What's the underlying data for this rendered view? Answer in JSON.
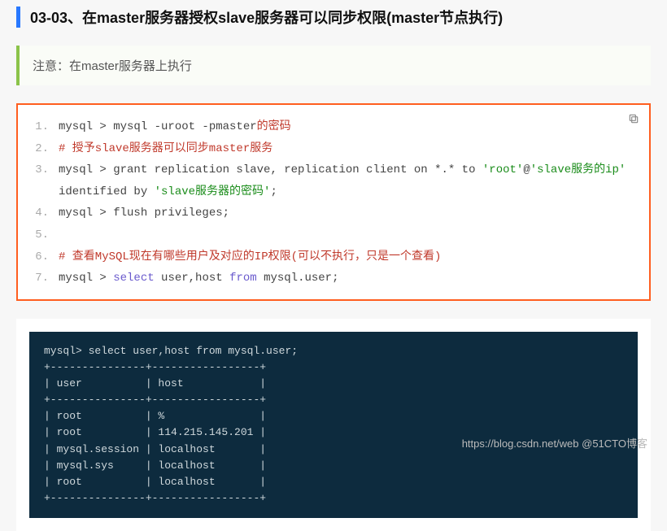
{
  "heading": "03-03、在master服务器授权slave服务器可以同步权限(master节点执行)",
  "note": "注意：在master服务器上执行",
  "code": {
    "lines": [
      {
        "n": "1.",
        "seg": [
          {
            "t": "mysql > mysql -uroot -pmaster",
            "cls": "c-prompt"
          },
          {
            "t": "的密码",
            "cls": "c-red"
          }
        ]
      },
      {
        "n": "2.",
        "seg": [
          {
            "t": "# 授予slave服务器可以同步master服务",
            "cls": "c-red"
          }
        ]
      },
      {
        "n": "3.",
        "seg": [
          {
            "t": "mysql > grant replication slave, replication client on *.* to ",
            "cls": "c-prompt"
          },
          {
            "t": "'root'",
            "cls": "c-str"
          },
          {
            "t": "@",
            "cls": "c-prompt"
          },
          {
            "t": "'slave服务的ip'",
            "cls": "c-str"
          },
          {
            "t": " identified by ",
            "cls": "c-prompt"
          },
          {
            "t": "'slave服务器的密码'",
            "cls": "c-str"
          },
          {
            "t": ";",
            "cls": "c-prompt"
          }
        ]
      },
      {
        "n": "4.",
        "seg": [
          {
            "t": "mysql > flush privileges;",
            "cls": "c-prompt"
          }
        ]
      },
      {
        "n": "5.",
        "seg": [
          {
            "t": " ",
            "cls": "c-prompt"
          }
        ]
      },
      {
        "n": "6.",
        "seg": [
          {
            "t": "# 查看MySQL现在有哪些用户及对应的IP权限(可以不执行，只是一个查看)",
            "cls": "c-red"
          }
        ]
      },
      {
        "n": "7.",
        "seg": [
          {
            "t": "mysql > ",
            "cls": "c-prompt"
          },
          {
            "t": "select",
            "cls": "c-kw"
          },
          {
            "t": " user,host ",
            "cls": "c-prompt"
          },
          {
            "t": "from",
            "cls": "c-kw"
          },
          {
            "t": " mysql.user;",
            "cls": "c-prompt"
          }
        ]
      }
    ]
  },
  "terminal": "mysql> select user,host from mysql.user;\n+---------------+-----------------+\n| user          | host            |\n+---------------+-----------------+\n| root          | %               |\n| root          | 114.215.145.201 |\n| mysql.session | localhost       |\n| mysql.sys     | localhost       |\n| root          | localhost       |\n+---------------+-----------------+",
  "watermark": "https://blog.csdn.net/web @51CTO博客"
}
